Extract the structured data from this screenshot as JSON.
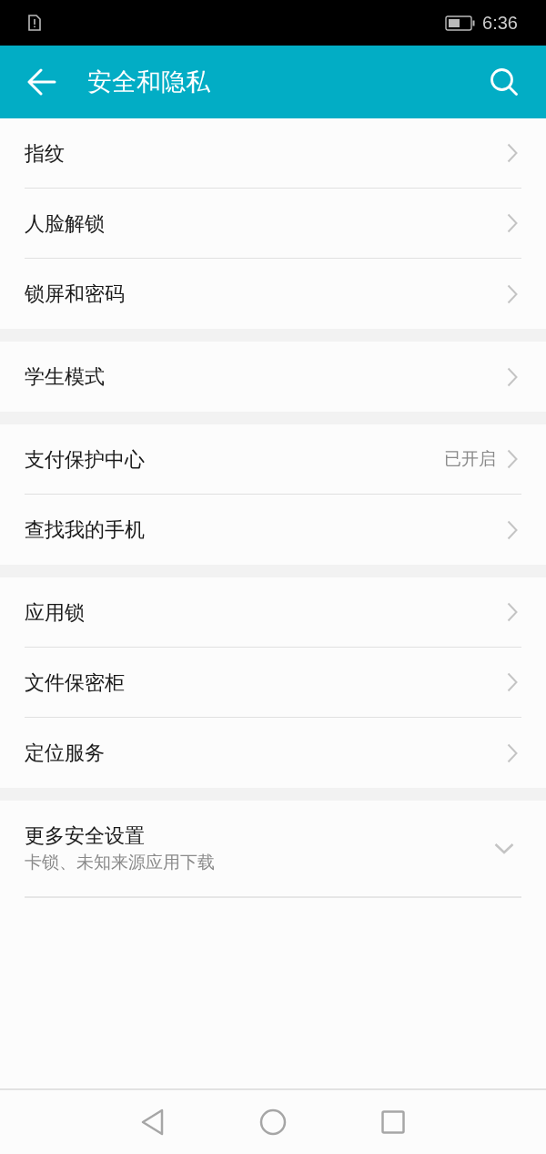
{
  "status_bar": {
    "time": "6:36"
  },
  "app_bar": {
    "title": "安全和隐私"
  },
  "groups": [
    {
      "items": [
        {
          "label": "指纹"
        },
        {
          "label": "人脸解锁"
        },
        {
          "label": "锁屏和密码"
        }
      ]
    },
    {
      "items": [
        {
          "label": "学生模式"
        }
      ]
    },
    {
      "items": [
        {
          "label": "支付保护中心",
          "value": "已开启"
        },
        {
          "label": "查找我的手机"
        }
      ]
    },
    {
      "items": [
        {
          "label": "应用锁"
        },
        {
          "label": "文件保密柜"
        },
        {
          "label": "定位服务"
        }
      ]
    }
  ],
  "more_settings": {
    "title": "更多安全设置",
    "subtitle": "卡锁、未知来源应用下载",
    "expanded": false
  }
}
